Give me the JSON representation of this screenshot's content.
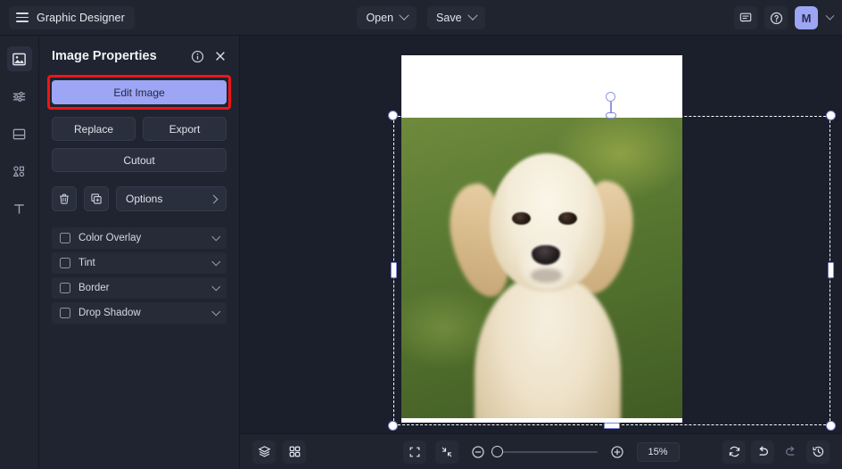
{
  "app": {
    "title": "Graphic Designer",
    "menu_icon": "hamburger-icon",
    "accent_purple": "#9da5f5",
    "highlight_red": "#f01515",
    "bg_dark": "#1b1e2b",
    "panel_bg": "#1f2430"
  },
  "topbar": {
    "open_label": "Open",
    "save_label": "Save",
    "feedback_icon": "chat-icon",
    "help_icon": "help-circle-icon",
    "avatar_initial": "M",
    "avatar_chevron": "chevron-down-icon"
  },
  "rail": {
    "items": [
      {
        "name": "image-tool",
        "icon": "image-icon",
        "active": true
      },
      {
        "name": "adjustments-tool",
        "icon": "sliders-icon",
        "active": false
      },
      {
        "name": "layout-tool",
        "icon": "frame-icon",
        "active": false
      },
      {
        "name": "shapes-tool",
        "icon": "shapes-icon",
        "active": false
      },
      {
        "name": "text-tool",
        "icon": "text-t-icon",
        "active": false
      }
    ]
  },
  "panel": {
    "title": "Image Properties",
    "info_icon": "info-circle-icon",
    "close_icon": "close-x-icon",
    "edit_image_label": "Edit Image",
    "replace_label": "Replace",
    "export_label": "Export",
    "cutout_label": "Cutout",
    "delete_icon": "trash-icon",
    "duplicate_icon": "duplicate-icon",
    "options_label": "Options",
    "options_chevron": "chevron-right-icon",
    "effects": [
      {
        "label": "Color Overlay",
        "checked": false
      },
      {
        "label": "Tint",
        "checked": false
      },
      {
        "label": "Border",
        "checked": false
      },
      {
        "label": "Drop Shadow",
        "checked": false
      }
    ]
  },
  "canvas": {
    "image_subject": "golden retriever puppy on grass",
    "selection_active": true,
    "rotate_handle_icon": "rotate-handle-icon"
  },
  "bottombar": {
    "layers_icon": "layers-icon",
    "grid_icon": "grid-icon",
    "fit_screen_icon": "fit-screen-icon",
    "fit_selection_icon": "shrink-icon",
    "zoom_out_icon": "zoom-out-icon",
    "zoom_in_icon": "zoom-in-icon",
    "zoom_level": "15%",
    "reset_icon": "reset-icon",
    "undo_icon": "undo-icon",
    "redo_icon": "redo-icon",
    "history_icon": "history-icon"
  }
}
